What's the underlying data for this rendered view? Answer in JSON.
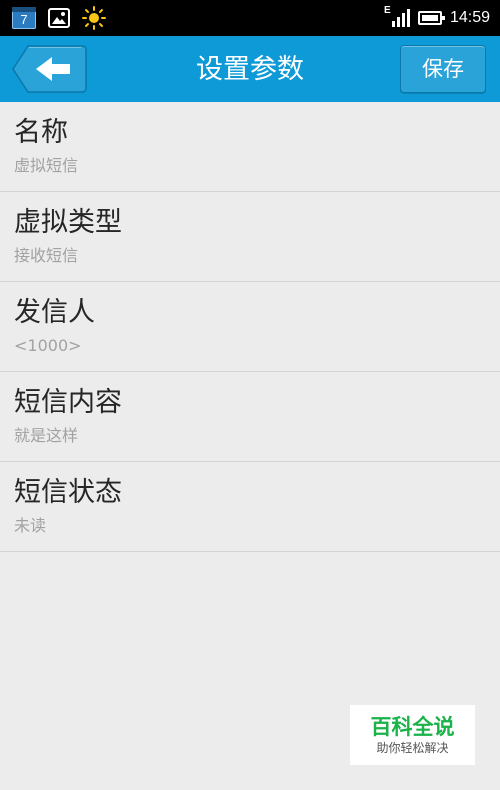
{
  "status_bar": {
    "calendar_day": "7",
    "network_type": "E",
    "time": "14:59",
    "icons": [
      "calendar-icon",
      "gallery-icon",
      "sun-icon",
      "signal-icon",
      "battery-icon"
    ]
  },
  "header": {
    "title": "设置参数",
    "save_label": "保存",
    "back_icon": "back-arrow-icon"
  },
  "settings": {
    "items": [
      {
        "title": "名称",
        "value": "虚拟短信"
      },
      {
        "title": "虚拟类型",
        "value": "接收短信"
      },
      {
        "title": "发信人",
        "value": "<1000>"
      },
      {
        "title": "短信内容",
        "value": "就是这样"
      },
      {
        "title": "短信状态",
        "value": "未读"
      }
    ]
  },
  "watermark": {
    "title": "百科全说",
    "subtitle": "助你轻松解决"
  },
  "colors": {
    "header_bg": "#0d9ad6",
    "page_bg": "#ececec",
    "title_text": "#262626",
    "value_text": "#a2a2a2",
    "watermark_green": "#1bb24a"
  }
}
